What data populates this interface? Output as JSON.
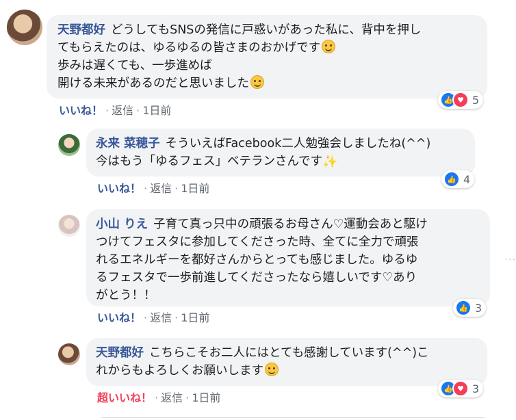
{
  "comments": [
    {
      "author": "天野都好",
      "lines": [
        "どうしてもSNSの発信に戸惑いがあった私に、背中を押し",
        "てもらえたのは、ゆるゆるの皆さまのおかげです",
        "歩みは遅くても、一歩進めば",
        "開ける未来があるのだと思いました"
      ],
      "like": "いいね！",
      "reply": "返信",
      "time": "1日前",
      "reaction_count": "5"
    },
    {
      "author": "永来 菜穂子",
      "lines": [
        "そういえばFacebook二人勉強会しましたね(^^)",
        "今はもう「ゆるフェス」ベテランさんです"
      ],
      "like": "いいね！",
      "reply": "返信",
      "time": "1日前",
      "reaction_count": "4"
    },
    {
      "author": "小山 りえ",
      "lines": [
        "子育て真っ只中の頑張るお母さん♡運動会あと駆け",
        "つけてフェスタに参加してくださった時、全てに全力で頑張",
        "れるエネルギーを都好さんからとっても感じました。ゆるゆ",
        "るフェスタで一歩前進してくださったなら嬉しいです♡あり",
        "がとう！！"
      ],
      "like": "いいね！",
      "reply": "返信",
      "time": "1日前",
      "reaction_count": "3"
    },
    {
      "author": "天野都好",
      "lines": [
        "こちらこそお二人にはとても感謝しています(^^)こ",
        "れからもよろしくお願いします"
      ],
      "like": "超いいね！",
      "reply": "返信",
      "time": "1日前",
      "reaction_count": "3"
    }
  ],
  "separator": "·",
  "more_icon": "...",
  "icons": {
    "like": "thumbs-up-icon",
    "love": "heart-icon",
    "smile": "smile-emoji-icon",
    "sparkle": "sparkle-emoji-icon",
    "more": "more-horizontal-icon"
  },
  "colors": {
    "author": "#385898",
    "superlike": "#f33e58",
    "like_reaction": "#1877f2",
    "love_reaction": "#f33e58",
    "bubble": "#f2f3f5"
  }
}
